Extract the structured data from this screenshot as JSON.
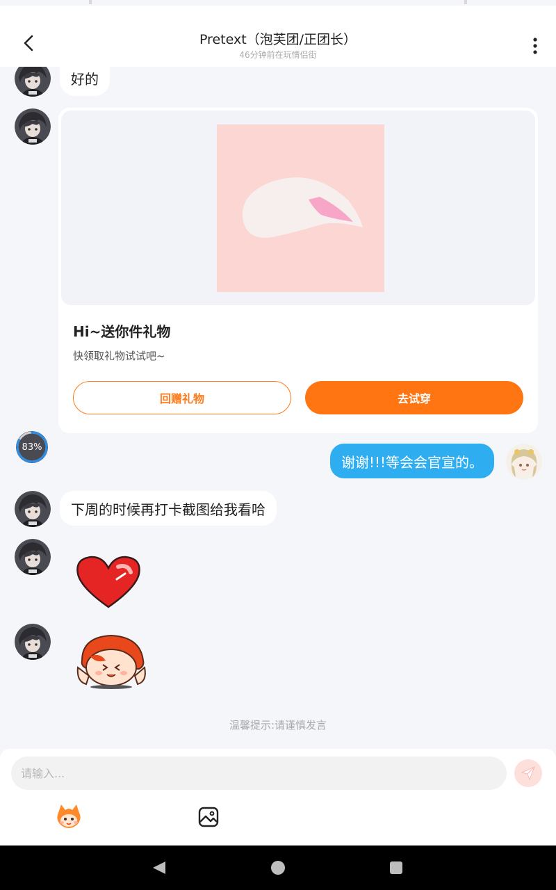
{
  "header": {
    "title": "Pretext（泡芙团/正团长）",
    "subtitle": "46分钟前在玩情侣街"
  },
  "messages": {
    "m1": "好的",
    "gift": {
      "title": "Hi~送你件礼物",
      "description": "快领取礼物试试吧~",
      "return_button": "回赠礼物",
      "try_button": "去试穿"
    },
    "upload_progress": "83%",
    "upload_progress_value": 0.83,
    "m2": "谢谢!!!等会会官宣的。",
    "m3": "下周的时候再打卡截图给我看哈"
  },
  "tip": "温馨提示:请谨慎发言",
  "input": {
    "placeholder": "请输入..."
  },
  "colors": {
    "accent": "#ff7512",
    "self_bubble": "#2eaef1",
    "background": "#f4f6fa"
  },
  "icons": {
    "back": "chevron-left-icon",
    "more": "more-vertical-icon",
    "send": "send-icon",
    "emoji": "mascot-emoji-icon",
    "image": "image-icon"
  }
}
